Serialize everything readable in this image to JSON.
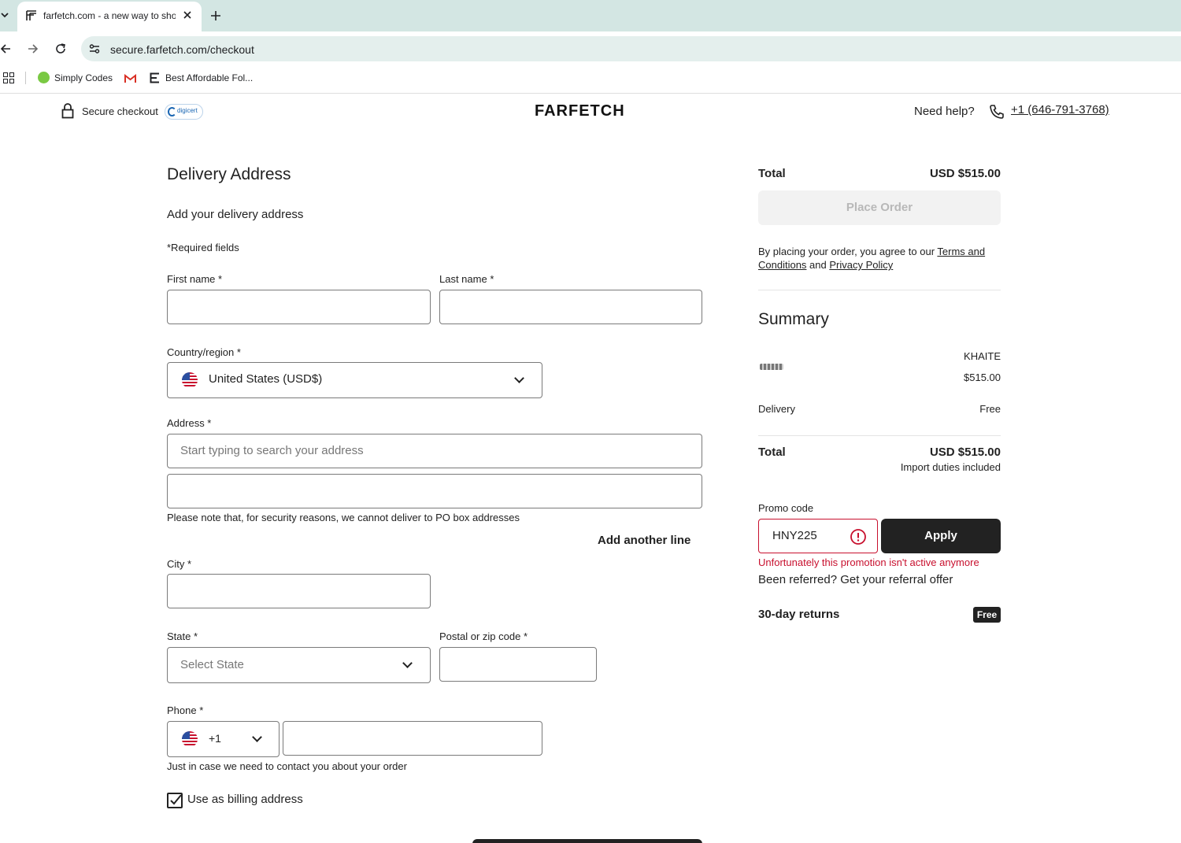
{
  "browser": {
    "tab_title": "farfetch.com - a new way to sho",
    "url": "secure.farfetch.com/checkout",
    "bookmarks": [
      {
        "label": "Simply Codes",
        "icon": "simply-codes-icon"
      },
      {
        "label": "",
        "icon": "gmail-icon"
      },
      {
        "label": "Best Affordable Fol...",
        "icon": "site-icon"
      }
    ]
  },
  "header": {
    "secure_checkout": "Secure checkout",
    "badge": "digicert",
    "logo": "FARFETCH",
    "need_help": "Need help?",
    "phone": "+1 (646-791-3768)"
  },
  "form": {
    "title": "Delivery Address",
    "subtitle": "Add your delivery address",
    "required_note": "*Required fields",
    "first_name_label": "First name *",
    "last_name_label": "Last name *",
    "country_label": "Country/region *",
    "country_value": "United States (USD$)",
    "address_label": "Address *",
    "address_placeholder": "Start typing to search your address",
    "po_box_note": "Please note that, for security reasons, we cannot deliver to PO box addresses",
    "add_line": "Add another line",
    "city_label": "City *",
    "state_label": "State *",
    "state_placeholder": "Select State",
    "zip_label": "Postal or zip code *",
    "phone_label": "Phone *",
    "phone_code": "+1",
    "phone_note": "Just in case we need to contact you about your order",
    "billing_label": "Use as billing address",
    "billing_checked": true
  },
  "sidebar": {
    "total_label": "Total",
    "total_value": "USD $515.00",
    "place_order": "Place Order",
    "terms_prefix": "By placing your order, you agree to our ",
    "terms_link": "Terms and Conditions",
    "terms_and": " and ",
    "privacy_link": "Privacy Policy",
    "summary_title": "Summary",
    "item_brand": "KHAITE",
    "item_price": "$515.00",
    "delivery_label": "Delivery",
    "delivery_value": "Free",
    "total2_label": "Total",
    "total2_value": "USD $515.00",
    "duties_note": "Import duties included",
    "promo_label": "Promo code",
    "promo_value": "HNY225",
    "apply": "Apply",
    "promo_error": "Unfortunately this promotion isn't active anymore",
    "referral": "Been referred? Get your referral offer",
    "returns_label": "30-day returns",
    "returns_badge": "Free"
  },
  "colors": {
    "error": "#c8102e",
    "button_dark": "#222222",
    "button_disabled": "#f2f2f2",
    "tabbar": "#d3e6e3"
  }
}
